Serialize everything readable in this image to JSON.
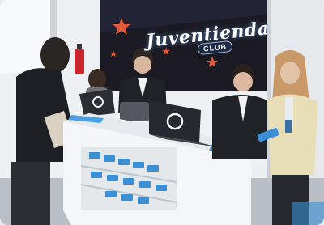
{
  "banner": {
    "title": "Juventienda",
    "subtitle": "CLUB"
  },
  "colors": {
    "banner_bg": "#1b1a23",
    "blazer_dark": "#1f2226",
    "blazer_cream": "#e7ddb6",
    "counter_white": "#f4f6f7",
    "phone_blue": "#3b8fd6",
    "star_red": "#e25a3a"
  },
  "icons": {
    "laptop_logo": "circle-logo-icon"
  }
}
